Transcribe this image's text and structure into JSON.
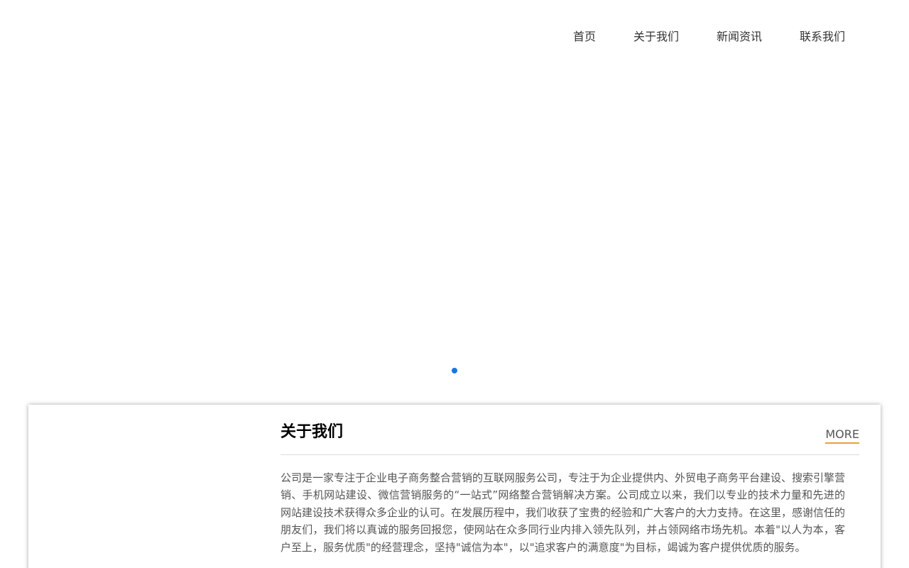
{
  "nav": {
    "items": [
      {
        "label": "首页"
      },
      {
        "label": "关于我们"
      },
      {
        "label": "新闻资讯"
      },
      {
        "label": "联系我们"
      }
    ]
  },
  "banner": {
    "slide_count": 1,
    "active_slide": 1,
    "dot_color": "#1677e6"
  },
  "about": {
    "title": "关于我们",
    "more_label": "MORE",
    "more_underline_color": "#e3a33b",
    "text": "公司是一家专注于企业电子商务整合营销的互联网服务公司，专注于为企业提供内、外贸电子商务平台建设、搜索引擎营销、手机网站建设、微信营销服务的“一站式”网络整合营销解决方案。公司成立以来，我们以专业的技术力量和先进的网站建设技术获得众多企业的认可。在发展历程中，我们收获了宝贵的经验和广大客户的大力支持。在这里，感谢信任的朋友们，我们将以真诚的服务回报您，使网站在众多同行业内排入领先队列，并占领网络市场先机。本着\"以人为本，客户至上，服务优质\"的经营理念，坚持\"诚信为本\"，以\"追求客户的满意度\"为目标，竭诚为客户提供优质的服务。"
  }
}
